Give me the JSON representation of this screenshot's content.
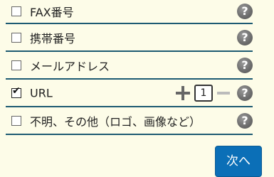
{
  "options": [
    {
      "label": "FAX番号",
      "checked": false
    },
    {
      "label": "携帯番号",
      "checked": false
    },
    {
      "label": "メールアドレス",
      "checked": false
    },
    {
      "label": "URL",
      "checked": true,
      "count": "1"
    },
    {
      "label": "不明、その他（ロゴ、画像など）",
      "checked": false
    }
  ],
  "help_glyph": "?",
  "check_glyph": "✔",
  "next_label": "次へ",
  "colors": {
    "background": "#fdfce8",
    "divider": "#1d5a72",
    "button": "#0b6fb7"
  }
}
